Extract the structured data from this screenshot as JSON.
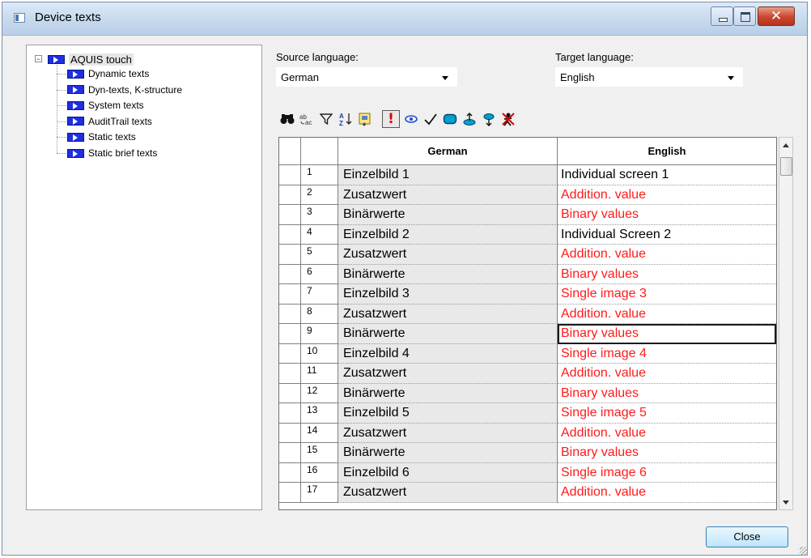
{
  "window": {
    "title": "Device texts"
  },
  "tree": {
    "root": "AQUIS touch",
    "items": [
      "Dynamic texts",
      "Dyn-texts, K-structure",
      "System texts",
      "AuditTrail texts",
      "Static texts",
      "Static brief texts"
    ]
  },
  "source": {
    "label": "Source language:",
    "value": "German"
  },
  "target": {
    "label": "Target language:",
    "value": "English"
  },
  "toolbar": {
    "icons": [
      "binoculars-icon",
      "replace-icon",
      "filter-icon",
      "sort-icon",
      "export-icon",
      "exclamation-icon",
      "eye-icon",
      "check-icon",
      "rounded-rect-icon",
      "upload-icon",
      "pin-icon",
      "cross-icon"
    ]
  },
  "grid": {
    "headers": {
      "german": "German",
      "english": "English"
    },
    "rows": [
      {
        "num": "1",
        "de": "Einzelbild 1",
        "en": "Individual screen 1",
        "color": "black"
      },
      {
        "num": "2",
        "de": "Zusatzwert",
        "en": "Addition. value",
        "color": "red"
      },
      {
        "num": "3",
        "de": "Binärwerte",
        "en": "Binary values",
        "color": "red"
      },
      {
        "num": "4",
        "de": "Einzelbild 2",
        "en": "Individual Screen 2",
        "color": "black"
      },
      {
        "num": "5",
        "de": "Zusatzwert",
        "en": "Addition. value",
        "color": "red"
      },
      {
        "num": "6",
        "de": "Binärwerte",
        "en": "Binary values",
        "color": "red"
      },
      {
        "num": "7",
        "de": "Einzelbild 3",
        "en": "Single image 3",
        "color": "red"
      },
      {
        "num": "8",
        "de": "Zusatzwert",
        "en": "Addition. value",
        "color": "red"
      },
      {
        "num": "9",
        "de": "Binärwerte",
        "en": "Binary values",
        "color": "red",
        "editing": true
      },
      {
        "num": "10",
        "de": "Einzelbild 4",
        "en": "Single image 4",
        "color": "red"
      },
      {
        "num": "11",
        "de": "Zusatzwert",
        "en": "Addition. value",
        "color": "red"
      },
      {
        "num": "12",
        "de": "Binärwerte",
        "en": "Binary values",
        "color": "red"
      },
      {
        "num": "13",
        "de": "Einzelbild 5",
        "en": "Single image 5",
        "color": "red"
      },
      {
        "num": "14",
        "de": "Zusatzwert",
        "en": "Addition. value",
        "color": "red"
      },
      {
        "num": "15",
        "de": "Binärwerte",
        "en": "Binary values",
        "color": "red"
      },
      {
        "num": "16",
        "de": "Einzelbild 6",
        "en": "Single image 6",
        "color": "red"
      },
      {
        "num": "17",
        "de": "Zusatzwert",
        "en": "Addition. value",
        "color": "red"
      }
    ]
  },
  "buttons": {
    "close": "Close"
  },
  "colors": {
    "untranslated": "#ff1a1a",
    "translated": "#000000"
  }
}
